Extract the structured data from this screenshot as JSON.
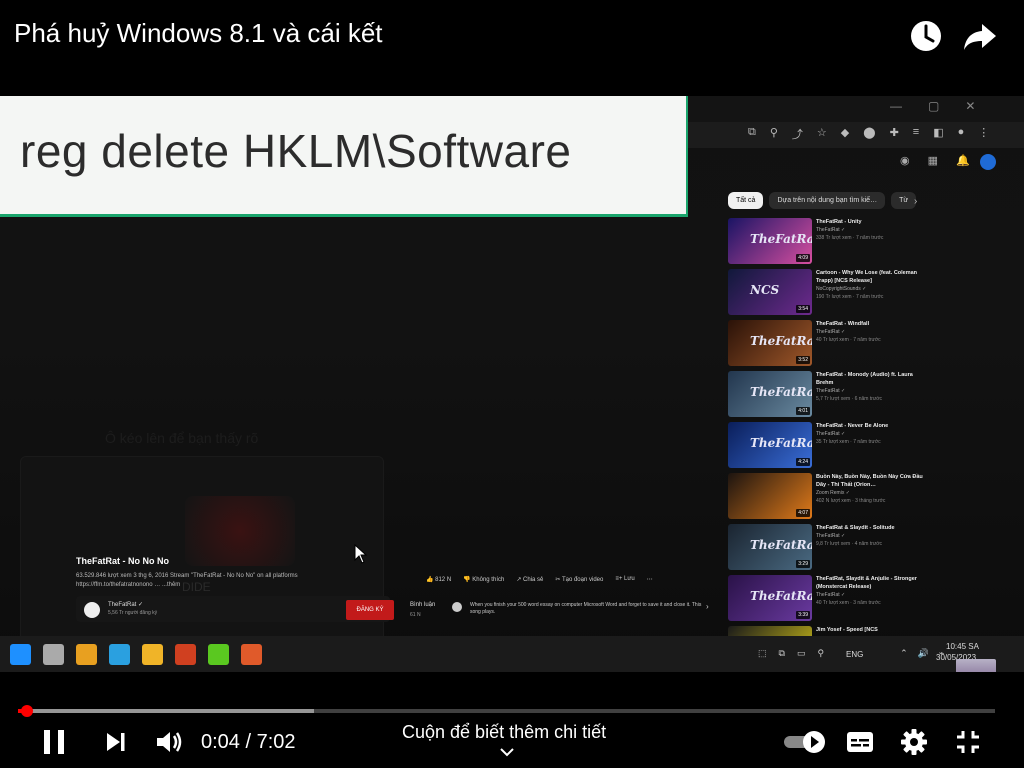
{
  "header": {
    "title": "Phá huỷ Windows 8.1 và cái kết",
    "watch_later_icon": "clock-icon",
    "share_icon": "share-arrow-icon"
  },
  "video": {
    "caption_overlay": "reg delete HKLM\\Software",
    "ghost_text": "Ô kéo lên để bạn thấy rõ",
    "bottom_faint_label": "DIDE",
    "chips": [
      "Tất cả",
      "Dựa trên nội dung bạn tìm kiế…",
      "Từ"
    ],
    "recommendations": [
      {
        "title": "TheFatRat - Unity",
        "channel": "TheFatRat ✓",
        "meta": "338 Tr lượt xem · 7 năm trước",
        "duration": "4:09",
        "thumb_label": "TheFatRat",
        "color_a": "#1a1464",
        "color_b": "#d74fa0"
      },
      {
        "title": "Cartoon - Why We Lose (feat. Coleman Trapp) [NCS Release]",
        "channel": "NoCopyrightSounds ✓",
        "meta": "190 Tr lượt xem · 7 năm trước",
        "duration": "3:54",
        "thumb_label": "NCS",
        "color_a": "#10183a",
        "color_b": "#6e2a8e"
      },
      {
        "title": "TheFatRat - Windfall",
        "channel": "TheFatRat ✓",
        "meta": "40 Tr lượt xem · 7 năm trước",
        "duration": "3:52",
        "thumb_label": "TheFatRat",
        "color_a": "#2a1208",
        "color_b": "#a0582a"
      },
      {
        "title": "TheFatRat - Monody (Audio) ft. Laura Brehm",
        "channel": "TheFatRat ✓",
        "meta": "5,7 Tr lượt xem · 6 năm trước",
        "duration": "4:01",
        "thumb_label": "TheFatRat",
        "color_a": "#22364e",
        "color_b": "#6a8aa0"
      },
      {
        "title": "TheFatRat - Never Be Alone",
        "channel": "TheFatRat ✓",
        "meta": "35 Tr lượt xem · 7 năm trước",
        "duration": "4:24",
        "thumb_label": "TheFatRat",
        "color_a": "#0a1e5a",
        "color_b": "#3a6ed8"
      },
      {
        "title": "Buồn Này, Buồn Này, Buồn Này Cứa Đầu Dây - Thi Thất (Orion…",
        "channel": "Zoom Remix ✓",
        "meta": "402 N lượt xem · 3 tháng trước",
        "duration": "4:07",
        "thumb_label": "",
        "color_a": "#1c1410",
        "color_b": "#e07a1a"
      },
      {
        "title": "TheFatRat & Slaydit - Solitude",
        "channel": "TheFatRat ✓",
        "meta": "9,8 Tr lượt xem · 4 năm trước",
        "duration": "3:29",
        "thumb_label": "TheFatRat",
        "color_a": "#1a2430",
        "color_b": "#4a6a82"
      },
      {
        "title": "TheFatRat, Slaydit & Anjulie - Stronger (Monstercat Release)",
        "channel": "TheFatRat ✓",
        "meta": "40 Tr lượt xem · 3 năm trước",
        "duration": "3:39",
        "thumb_label": "TheFatRat",
        "color_a": "#2a1248",
        "color_b": "#6a3aa0"
      },
      {
        "title": "Jim Yosef - Speed [NCS",
        "channel": "",
        "meta": "",
        "duration": "",
        "thumb_label": "",
        "color_a": "#1a1a1a",
        "color_b": "#d8c81a"
      }
    ],
    "main_video": {
      "title": "TheFatRat - No No No",
      "stats": "63.529.846 lượt xem  3 thg 6, 2016  Stream \"TheFatRat - No No No\" on all platforms",
      "more": "https://ffm.to/thefatratnonono … ...thêm",
      "channel": "TheFatRat ✓",
      "subs": "5,56 Tr người đăng ký",
      "subscribe": "ĐĂNG KÝ"
    },
    "actions": [
      "👍 812 N",
      "👎 Không thích",
      "↗ Chia sẻ",
      "✂ Tạo đoạn video",
      "≡+ Lưu",
      "⋯"
    ],
    "comments": {
      "label": "Bình luận",
      "count": "61 N",
      "preview": "When you finish your 500 word essay on computer Microsoft Word and forget to save it and close it. This song plays.",
      "arrow": "›"
    },
    "taskbar": {
      "apps": [
        "#1e90ff",
        "#aaaaaa",
        "#e8a020",
        "#2aa0e0",
        "#f0b428",
        "#d04020",
        "#5ac820",
        "#e05a2a"
      ],
      "tray": [
        "⬚",
        "⧉",
        "▭",
        "⚲"
      ],
      "lang": "ENG",
      "tray2": [
        "⌃",
        "🔊",
        "⌁"
      ],
      "time": "10:45 SA",
      "date": "30/05/2023"
    }
  },
  "controls": {
    "time": "0:04 / 7:02",
    "scroll_hint": "Cuộn để biết thêm chi tiết",
    "progress_played_fraction": 0.004,
    "progress_loaded_fraction": 0.303
  }
}
